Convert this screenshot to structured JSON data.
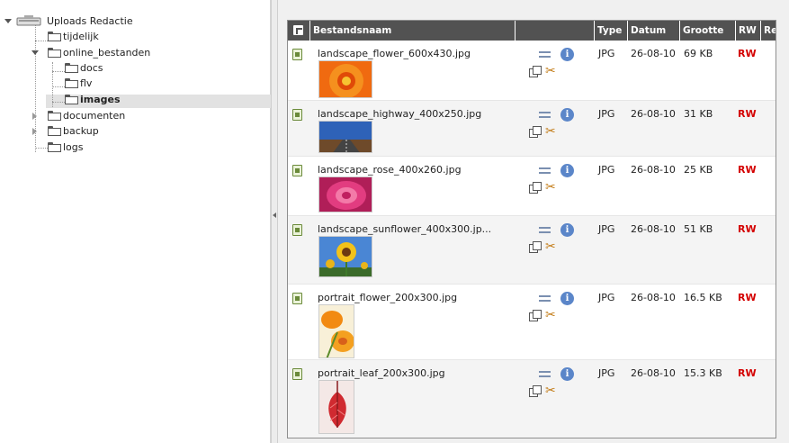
{
  "tree": {
    "root": "Uploads Redactie",
    "nodes": [
      {
        "label": "tijdelijk"
      },
      {
        "label": "online_bestanden"
      },
      {
        "label": "docs"
      },
      {
        "label": "flv"
      },
      {
        "label": "images"
      },
      {
        "label": "documenten"
      },
      {
        "label": "backup"
      },
      {
        "label": "logs"
      }
    ]
  },
  "grid": {
    "columns": [
      "Bestandsnaam",
      "Type",
      "Datum",
      "Grootte",
      "RW",
      "Ref"
    ],
    "rows": [
      {
        "name": "landscape_flower_600x430.jpg",
        "type": "JPG",
        "date": "26-08-10",
        "size": "69 KB",
        "rw": "RW"
      },
      {
        "name": "landscape_highway_400x250.jpg",
        "type": "JPG",
        "date": "26-08-10",
        "size": "31 KB",
        "rw": "RW"
      },
      {
        "name": "landscape_rose_400x260.jpg",
        "type": "JPG",
        "date": "26-08-10",
        "size": "25 KB",
        "rw": "RW"
      },
      {
        "name": "landscape_sunflower_400x300.jp...",
        "type": "JPG",
        "date": "26-08-10",
        "size": "51 KB",
        "rw": "RW"
      },
      {
        "name": "portrait_flower_200x300.jpg",
        "type": "JPG",
        "date": "26-08-10",
        "size": "16.5 KB",
        "rw": "RW"
      },
      {
        "name": "portrait_leaf_200x300.jpg",
        "type": "JPG",
        "date": "26-08-10",
        "size": "15.3 KB",
        "rw": "RW"
      }
    ]
  },
  "icons": {
    "row_file": "image-file-icon",
    "edit": "edit-icon",
    "info": "info-icon",
    "copy": "copy-icon",
    "cut": "cut-icon",
    "header": "select-all-icon"
  },
  "colors": {
    "header_bg": "#525252",
    "rw": "#d40000",
    "selected": "#e2e2e2"
  }
}
